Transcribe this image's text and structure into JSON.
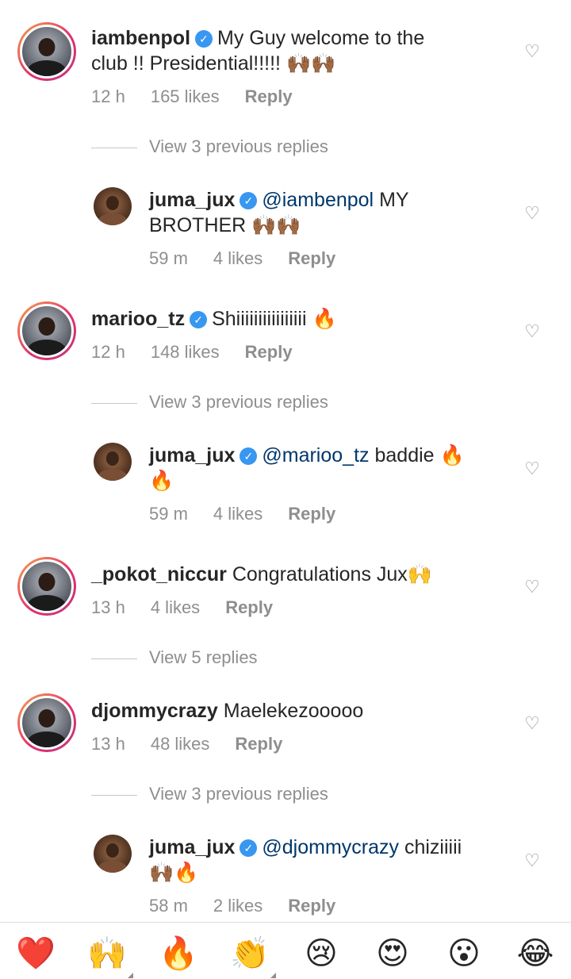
{
  "comments": [
    {
      "username": "iambenpol",
      "line1": "My Guy welcome to the",
      "line2": "club !! Presidential!!!!! 🙌🏾🙌🏾",
      "time": "12 h",
      "likes": "165 likes",
      "reply": "Reply",
      "view_replies": "View 3 previous replies"
    },
    {
      "username": "juma_jux",
      "mention": "@iambenpol",
      "line1": "MY",
      "line2": "BROTHER 🙌🏾🙌🏾",
      "time": "59 m",
      "likes": "4 likes",
      "reply": "Reply"
    },
    {
      "username": "marioo_tz",
      "line1": "Shiiiiiiiiiiiiiiii 🔥",
      "time": "12 h",
      "likes": "148 likes",
      "reply": "Reply",
      "view_replies": "View 3 previous replies"
    },
    {
      "username": "juma_jux",
      "mention": "@marioo_tz",
      "line1": "baddie 🔥",
      "line2": "🔥",
      "time": "59 m",
      "likes": "4 likes",
      "reply": "Reply"
    },
    {
      "username": "_pokot_niccur",
      "line1": "Congratulations Jux🙌",
      "time": "13 h",
      "likes": "4 likes",
      "reply": "Reply",
      "view_replies": "View 5 replies"
    },
    {
      "username": "djommycrazy",
      "line1": "Maelekezooooo",
      "time": "13 h",
      "likes": "48 likes",
      "reply": "Reply",
      "view_replies": "View 3 previous replies"
    },
    {
      "username": "juma_jux",
      "mention": "@djommycrazy",
      "line1": "chiziiiii",
      "line2": "🙌🏾🔥",
      "time": "58 m",
      "likes": "2 likes",
      "reply": "Reply"
    }
  ],
  "icons": {
    "verified": "verified-badge-icon",
    "like": "heart-outline-icon"
  },
  "emoji_bar": [
    "❤️",
    "🙌",
    "🔥",
    "👏",
    "😢",
    "😍",
    "😮",
    "😂"
  ],
  "colors": {
    "verified": "#3897f0",
    "mention": "#00376b",
    "meta": "#8e8e8e",
    "heart_red": "#ed4956"
  }
}
